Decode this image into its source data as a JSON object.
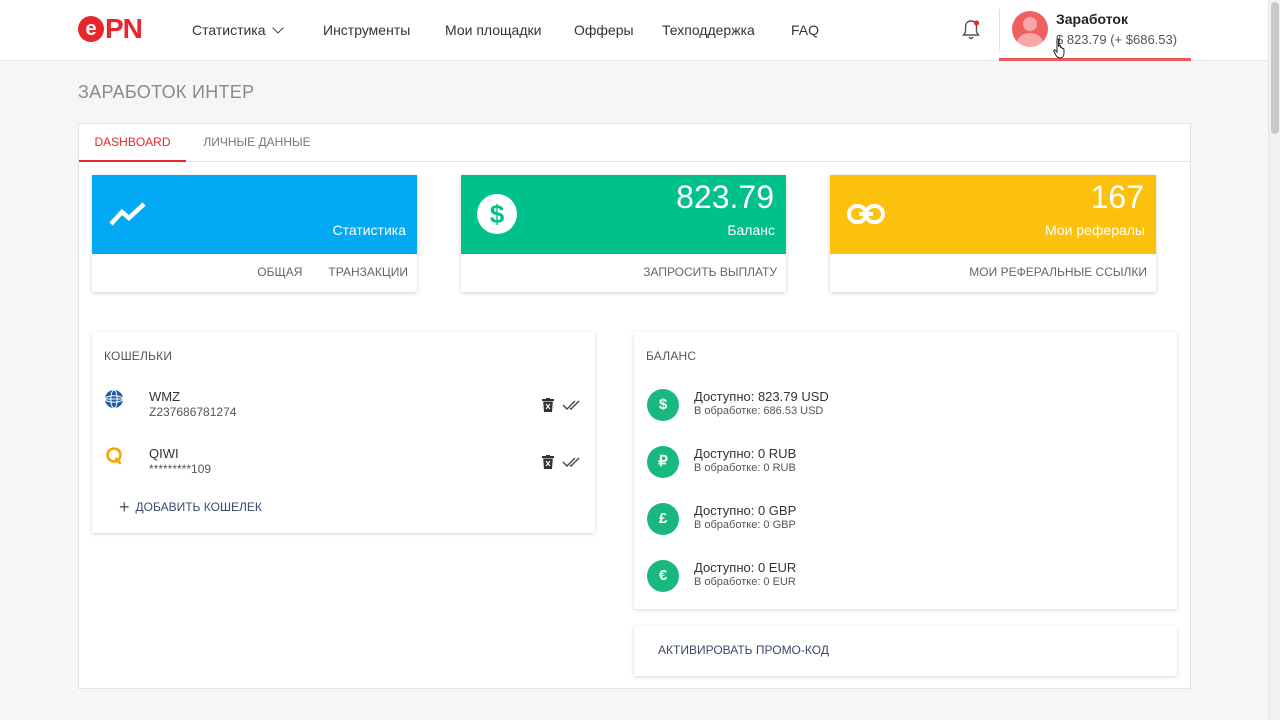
{
  "logo": {
    "e": "e",
    "pn": "PN"
  },
  "nav": {
    "items": [
      {
        "label": "Статистика"
      },
      {
        "label": "Инструменты"
      },
      {
        "label": "Мои площадки"
      },
      {
        "label": "Офферы"
      },
      {
        "label": "Техподдержка"
      },
      {
        "label": "FAQ"
      }
    ]
  },
  "user": {
    "name": "Заработок",
    "balance": "$ 823.79 (+ $686.53)"
  },
  "page": {
    "title": "ЗАРАБОТОК ИНТЕР"
  },
  "tabs": [
    {
      "label": "DASHBOARD",
      "active": true
    },
    {
      "label": "ЛИЧНЫЕ ДАННЫЕ",
      "active": false
    }
  ],
  "cards": {
    "stats": {
      "label": "Статистика",
      "links": [
        "ОБЩАЯ",
        "ТРАНЗАКЦИИ"
      ],
      "color": "#03a9f4"
    },
    "balance": {
      "value": "823.79",
      "label": "Баланс",
      "links": [
        "ЗАПРОСИТЬ ВЫПЛАТУ"
      ],
      "color": "#00c08b"
    },
    "referrals": {
      "value": "167",
      "label": "Мои рефералы",
      "links": [
        "МОИ РЕФЕРАЛЬНЫЕ ССЫЛКИ"
      ],
      "color": "#fcc10c"
    }
  },
  "wallets": {
    "title": "КОШЕЛЬКИ",
    "items": [
      {
        "name": "WMZ",
        "number": "Z237686781274",
        "icon": "webmoney-icon"
      },
      {
        "name": "QIWI",
        "number": "*********109",
        "icon": "qiwi-icon"
      }
    ],
    "add_label": "ДОБАВИТЬ КОШЕЛЕК"
  },
  "balance": {
    "title": "БАЛАНС",
    "rows": [
      {
        "symbol": "$",
        "available": "Доступно: 823.79 USD",
        "processing": "В обработке: 686.53 USD"
      },
      {
        "symbol": "₽",
        "available": "Доступно: 0 RUB",
        "processing": "В обработке: 0 RUB"
      },
      {
        "symbol": "£",
        "available": "Доступно: 0 GBP",
        "processing": "В обработке: 0 GBP"
      },
      {
        "symbol": "€",
        "available": "Доступно: 0 EUR",
        "processing": "В обработке: 0 EUR"
      }
    ],
    "accent": "#19b87e"
  },
  "promo": {
    "label": "АКТИВИРОВАТЬ ПРОМО-КОД"
  }
}
